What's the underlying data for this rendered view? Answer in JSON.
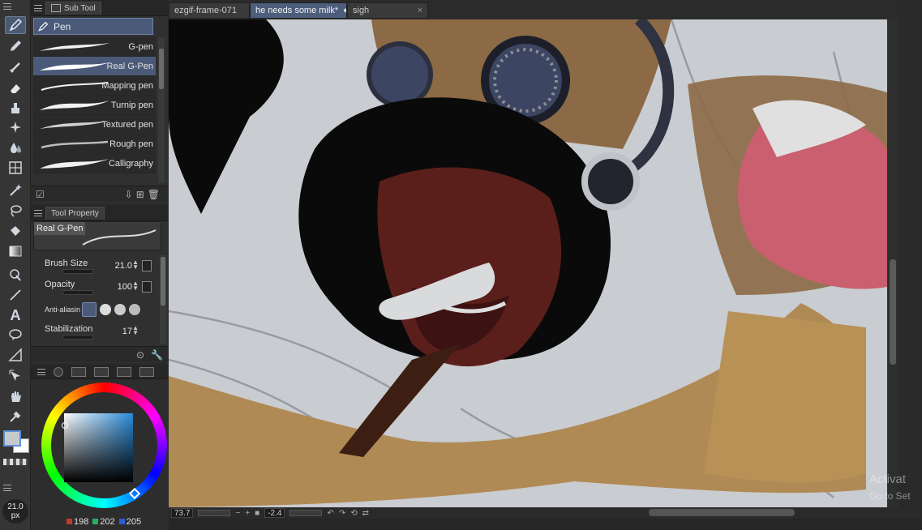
{
  "left_tools": {
    "icons": [
      "pen-icon",
      "pencil-icon",
      "marker-icon",
      "eraser-icon",
      "fill-pot-icon",
      "sparkle-icon",
      "blend-drop-icon",
      "grid-icon",
      "magic-wand-icon",
      "lasso-icon",
      "paint-bucket-icon",
      "gradient-icon",
      "operation-icon",
      "line-icon",
      "text-icon",
      "balloon-icon",
      "ruler-icon",
      "move-icon",
      "hand-icon",
      "eyedropper-icon"
    ],
    "brush_size_value": "21.0",
    "brush_size_unit": "px"
  },
  "subtool": {
    "tab_label": "Sub Tool",
    "group_label": "Pen",
    "items": [
      {
        "label": "G-pen"
      },
      {
        "label": "Real G-Pen"
      },
      {
        "label": "Mapping pen"
      },
      {
        "label": "Turnip pen"
      },
      {
        "label": "Textured pen"
      },
      {
        "label": "Rough pen"
      },
      {
        "label": "Calligraphy"
      }
    ],
    "selected_index": 1
  },
  "tool_property": {
    "tab_label": "Tool Property",
    "preview_label": "Real G-Pen",
    "brush_size_label": "Brush Size",
    "brush_size_value": "21.0",
    "opacity_label": "Opacity",
    "opacity_value": "100",
    "antialias_label": "Anti-aliasin",
    "stabilization_label": "Stabilization",
    "stabilization_value": "17"
  },
  "color": {
    "r": "198",
    "g": "202",
    "b": "205",
    "r_color": "#c0392b",
    "g_color": "#27ae60",
    "b_color": "#2f5bd8",
    "current_color": "#c6cacd"
  },
  "documents": {
    "tabs": [
      {
        "label": "ezgif-frame-071",
        "close": "×"
      },
      {
        "label": "he needs some milk*",
        "close": "●"
      },
      {
        "label": "sigh",
        "close": "×"
      }
    ],
    "active_index": 1
  },
  "status": {
    "zoom": "73.7",
    "rotation": "-2.4"
  },
  "watermark": {
    "line1": "Activat",
    "line2": "Go to Set"
  }
}
